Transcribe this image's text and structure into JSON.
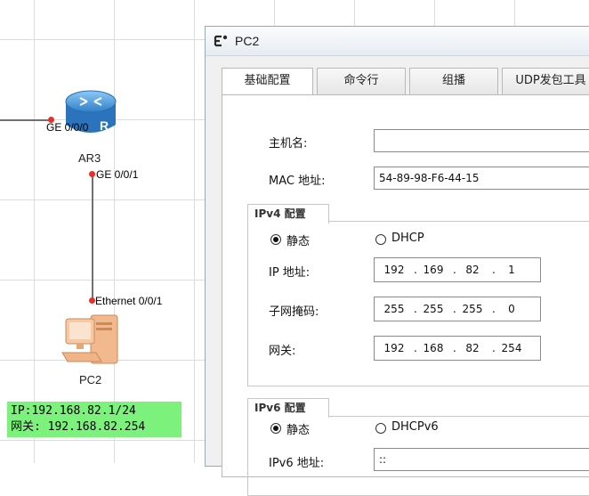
{
  "topology": {
    "router": {
      "name": "AR3",
      "ports": [
        "GE 0/0/0",
        "GE 0/0/1"
      ]
    },
    "pc": {
      "name": "PC2",
      "port": "Ethernet 0/0/1"
    },
    "note": {
      "line1": "IP:192.168.82.1/24",
      "line2": "网关: 192.168.82.254"
    },
    "colors": {
      "note_bg": "#7cf27c",
      "port_dot": "#e8302a",
      "router": "#3a8fd6"
    }
  },
  "window": {
    "title": "PC2",
    "tabs": [
      "基础配置",
      "命令行",
      "组播",
      "UDP发包工具"
    ],
    "active_tab": "基础配置",
    "form": {
      "hostname_label": "主机名:",
      "hostname_value": "",
      "mac_label": "MAC 地址:",
      "mac_value": "54-89-98-F6-44-15",
      "ipv4_group": "IPv4 配置",
      "static_label": "静态",
      "dhcp_label": "DHCP",
      "ipv4_mode": "静态",
      "ip_label": "IP 地址:",
      "ip": [
        "192",
        "169",
        "82",
        "1"
      ],
      "mask_label": "子网掩码:",
      "mask": [
        "255",
        "255",
        "255",
        "0"
      ],
      "gateway_label": "网关:",
      "gateway": [
        "192",
        "168",
        "82",
        "254"
      ],
      "ipv6_group": "IPv6 配置",
      "static6_label": "静态",
      "dhcpv6_label": "DHCPv6",
      "ipv6_mode": "静态",
      "ipv6_label": "IPv6 地址:",
      "ipv6_value": "::"
    }
  }
}
